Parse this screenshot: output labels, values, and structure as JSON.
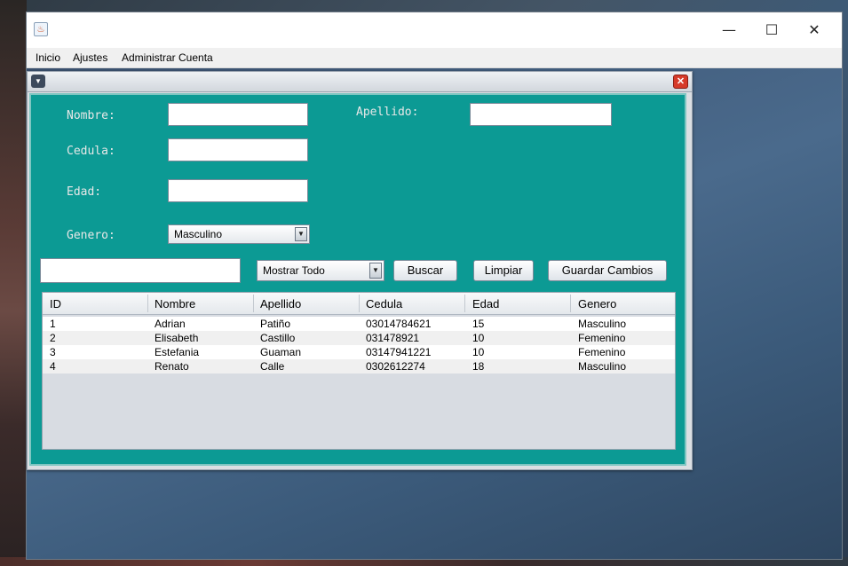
{
  "window": {
    "minimize": "—",
    "maximize": "☐",
    "close": "✕"
  },
  "menu": {
    "items": [
      "Inicio",
      "Ajustes",
      "Administrar Cuenta"
    ]
  },
  "form": {
    "nombre_label": "Nombre:",
    "apellido_label": "Apellido:",
    "cedula_label": "Cedula:",
    "edad_label": "Edad:",
    "genero_label": "Genero:",
    "nombre_value": "",
    "apellido_value": "",
    "cedula_value": "",
    "edad_value": "",
    "genero_selected": "Masculino"
  },
  "toolbar": {
    "search_value": "",
    "filter_selected": "Mostrar Todo",
    "buscar_label": "Buscar",
    "limpiar_label": "Limpiar",
    "guardar_label": "Guardar Cambios"
  },
  "table": {
    "columns": [
      "ID",
      "Nombre",
      "Apellido",
      "Cedula",
      "Edad",
      "Genero"
    ],
    "rows": [
      [
        "1",
        "Adrian",
        "Patiño",
        "03014784621",
        "15",
        "Masculino"
      ],
      [
        "2",
        "Elisabeth",
        "Castillo",
        "031478921",
        "10",
        "Femenino"
      ],
      [
        "3",
        "Estefania",
        "Guaman",
        "03147941221",
        "10",
        "Femenino"
      ],
      [
        "4",
        "Renato",
        "Calle",
        "0302612274",
        "18",
        "Masculino"
      ]
    ]
  },
  "colors": {
    "form_background": "#0c9a94",
    "close_button": "#d63b2a"
  }
}
